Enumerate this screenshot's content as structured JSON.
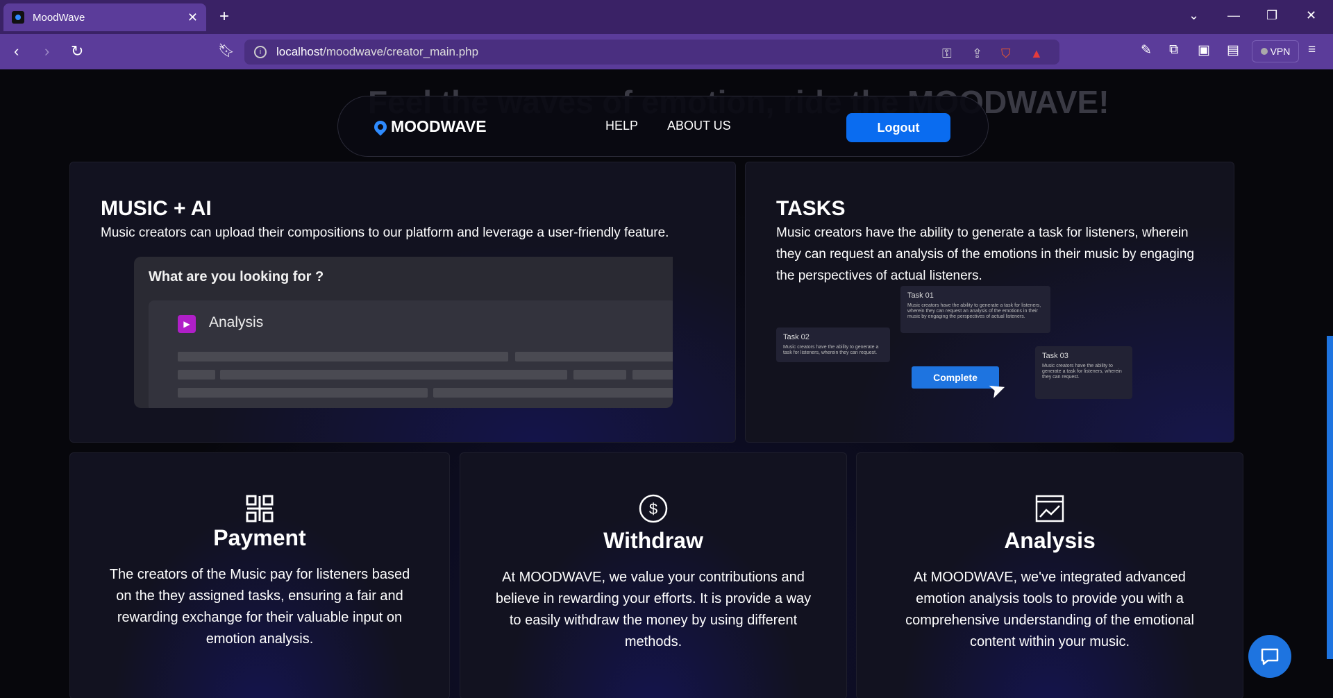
{
  "browser": {
    "tab_title": "MoodWave",
    "new_tab": "+",
    "url_host": "localhost",
    "url_path": "/moodwave/creator_main.php",
    "vpn_label": "VPN"
  },
  "hero": {
    "text": "Feel the waves of emotion, ride the MOODWAVE!"
  },
  "nav": {
    "logo": "MOODWAVE",
    "help": "HELP",
    "about": "ABOUT US",
    "logout": "Logout"
  },
  "music_ai": {
    "title": "MUSIC + AI",
    "desc": "Music creators can upload their compositions to our platform and leverage a user-friendly feature.",
    "mock_question": "What are you looking for ?",
    "mock_item": "Analysis"
  },
  "tasks": {
    "title": "TASKS",
    "desc": "Music creators have the ability to generate a task for listeners, wherein they can request an analysis of the emotions in their music by engaging the perspectives of actual listeners.",
    "task1_title": "Task 01",
    "task1_body": "Music creators have the ability to generate a task for listeners, wherein they can request an analysis of the emotions in their music by engaging the perspectives of actual listeners.",
    "task2_title": "Task 02",
    "task2_body": "Music creators have the ability to generate a task for listeners, wherein they can request.",
    "task3_title": "Task 03",
    "task3_body": "Music creators have the ability to generate a task for listeners, wherein they can request.",
    "complete": "Complete"
  },
  "features": {
    "payment_title": "Payment",
    "payment_desc": "The creators of the Music pay for listeners based on the they assigned tasks, ensuring a fair and rewarding exchange for their valuable input on emotion analysis.",
    "withdraw_title": "Withdraw",
    "withdraw_desc": "At MOODWAVE, we value your contributions and believe in rewarding your efforts. It is provide a way to easily withdraw the money by using different methods.",
    "analysis_title": "Analysis",
    "analysis_desc": "At MOODWAVE, we've integrated advanced emotion analysis tools to provide you with a comprehensive understanding of the emotional content within your music."
  },
  "colors": {
    "accent": "#0a6cf0",
    "tabbar": "#3a2266",
    "toolbar": "#5b3c9a"
  }
}
